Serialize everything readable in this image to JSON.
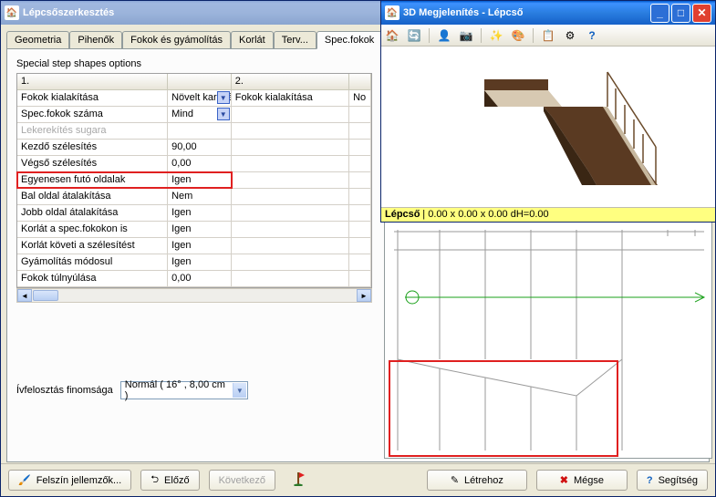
{
  "mainWindow": {
    "title": "Lépcsőszerkesztés"
  },
  "tabs": [
    "Geometria",
    "Pihenők",
    "Fokok és gyámolítás",
    "Korlát",
    "Terv...",
    "Spec.fokok"
  ],
  "activeTab": 5,
  "sectionLabel": "Special step shapes options",
  "colHeaders": {
    "c1": "1.",
    "c2": "2."
  },
  "rows": [
    {
      "label": "Fokok kialakítása",
      "v1": "Növelt karszéle",
      "dd1": true,
      "v2label": "Fokok kialakítása",
      "v2": "No",
      "dd1b": false
    },
    {
      "label": "Spec.fokok száma",
      "v1": "Mind",
      "dd1": true,
      "v2label": "",
      "v2": ""
    },
    {
      "label": "Lekerekítés sugara",
      "disabled": true,
      "v1": "",
      "v2label": "",
      "v2": ""
    },
    {
      "label": "Kezdő szélesítés",
      "v1": "90,00",
      "v2label": "",
      "v2": ""
    },
    {
      "label": "Végső szélesítés",
      "v1": "0,00",
      "v2label": "",
      "v2": ""
    },
    {
      "label": "Egyenesen futó oldalak",
      "v1": "Igen",
      "v2label": "",
      "v2": "",
      "hl": true
    },
    {
      "label": "Bal oldal átalakítása",
      "v1": "Nem",
      "v2label": "",
      "v2": ""
    },
    {
      "label": "Jobb oldal átalakítása",
      "v1": "Igen",
      "v2label": "",
      "v2": ""
    },
    {
      "label": "Korlát a spec.fokokon is",
      "v1": "Igen",
      "v2label": "",
      "v2": ""
    },
    {
      "label": "Korlát követi a szélesítést",
      "v1": "Igen",
      "v2label": "",
      "v2": ""
    },
    {
      "label": "Gyámolítás módosul",
      "v1": "Igen",
      "v2label": "",
      "v2": ""
    },
    {
      "label": "Fokok túlnyúlása",
      "v1": "0,00",
      "v2label": "",
      "v2": ""
    }
  ],
  "fineness": {
    "label": "Ívfelosztás finomsága",
    "value": "Normál ( 16° , 8,00 cm )"
  },
  "buttons": {
    "surface": "Felszín jellemzők...",
    "prev": "Előző",
    "next": "Következő",
    "create": "Létrehoz",
    "cancel": "Mégse",
    "help": "Segítség"
  },
  "viewer": {
    "title": "3D Megjelenítés - Lépcső",
    "status_label": "Lépcső",
    "status_coords": "0.00 x 0.00 x 0.00 dH=0.00"
  }
}
